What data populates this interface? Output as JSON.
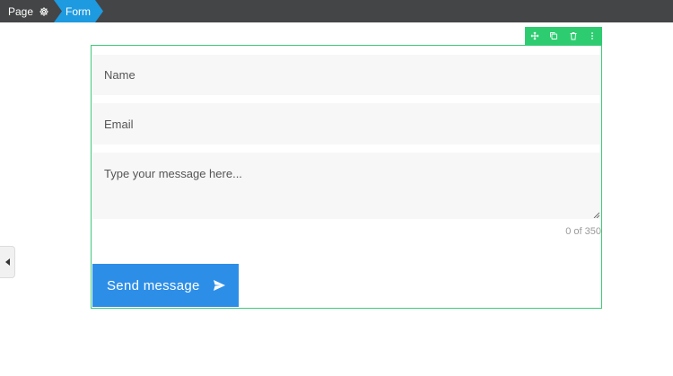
{
  "breadcrumb": {
    "page_label": "Page",
    "form_label": "Form"
  },
  "widget_toolbar": {
    "icons": [
      "move-icon",
      "duplicate-icon",
      "trash-icon",
      "more-vertical-icon"
    ]
  },
  "form": {
    "name_placeholder": "Name",
    "email_placeholder": "Email",
    "message_placeholder": "Type your message here...",
    "char_counter": "0 of 350",
    "submit_label": "Send message"
  },
  "colors": {
    "topbar": "#444546",
    "breadcrumb_active": "#1e9ae0",
    "selection": "#2ecc71",
    "button": "#2d8ee8",
    "field_bg": "#f7f7f7"
  }
}
